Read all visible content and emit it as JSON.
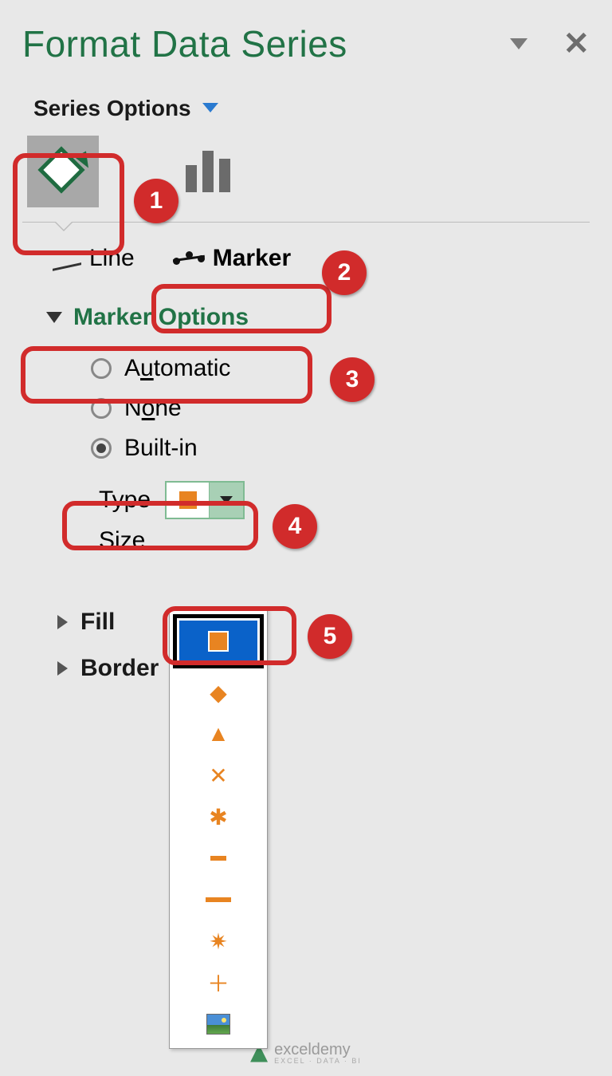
{
  "panel": {
    "title": "Format Data Series",
    "section_label": "Series Options"
  },
  "tabs": {
    "line": "Line",
    "marker": "Marker"
  },
  "sections": {
    "marker_options": "Marker Options",
    "fill": "Fill",
    "border": "Border"
  },
  "radios": {
    "automatic_pre": "A",
    "automatic_u": "u",
    "automatic_post": "tomatic",
    "none_pre": "N",
    "none_u": "o",
    "none_post": "ne",
    "builtin": "Built-in"
  },
  "fields": {
    "type": "Type",
    "size": "Size"
  },
  "dropdown": {
    "items": [
      "square",
      "diamond",
      "triangle",
      "x",
      "asterisk",
      "short-dash",
      "long-dash",
      "star",
      "plus",
      "picture"
    ]
  },
  "callouts": {
    "c1": "1",
    "c2": "2",
    "c3": "3",
    "c4": "4",
    "c5": "5"
  },
  "watermark": {
    "name": "exceldemy",
    "sub": "EXCEL · DATA · BI"
  }
}
